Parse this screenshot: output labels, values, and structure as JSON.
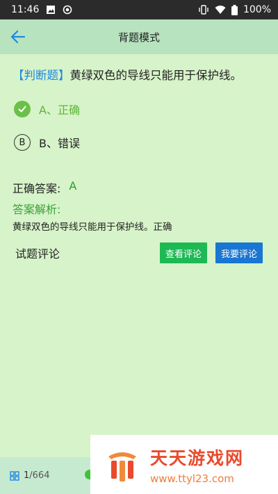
{
  "status_bar": {
    "time": "11:46",
    "battery": "100%"
  },
  "app_bar": {
    "title": "背题模式"
  },
  "question": {
    "tag": "【判断题】",
    "text": "黄绿双色的导线只能用于保护线。"
  },
  "options": [
    {
      "badge": "A",
      "label": "A、正确",
      "selected": true
    },
    {
      "badge": "B",
      "label": "B、错误",
      "selected": false
    }
  ],
  "answer": {
    "label": "正确答案:",
    "value": "A"
  },
  "analysis": {
    "title": "答案解析:",
    "text": "黄绿双色的导线只能用于保护线。正确"
  },
  "comments": {
    "label": "试题评论",
    "view_button": "查看评论",
    "mine_button": "我要评论"
  },
  "bottom_bar": {
    "current": "1",
    "total": "/664"
  },
  "watermark": {
    "title": "天天游戏网",
    "url": "www.ttyl23.com"
  },
  "colors": {
    "page_bg": "#d7f3c9",
    "app_bar_bg": "#b7e3bf",
    "tag_blue": "#1e88e5",
    "correct_green": "#6cc04a",
    "view_btn": "#1db954",
    "mine_btn": "#1976d2"
  }
}
